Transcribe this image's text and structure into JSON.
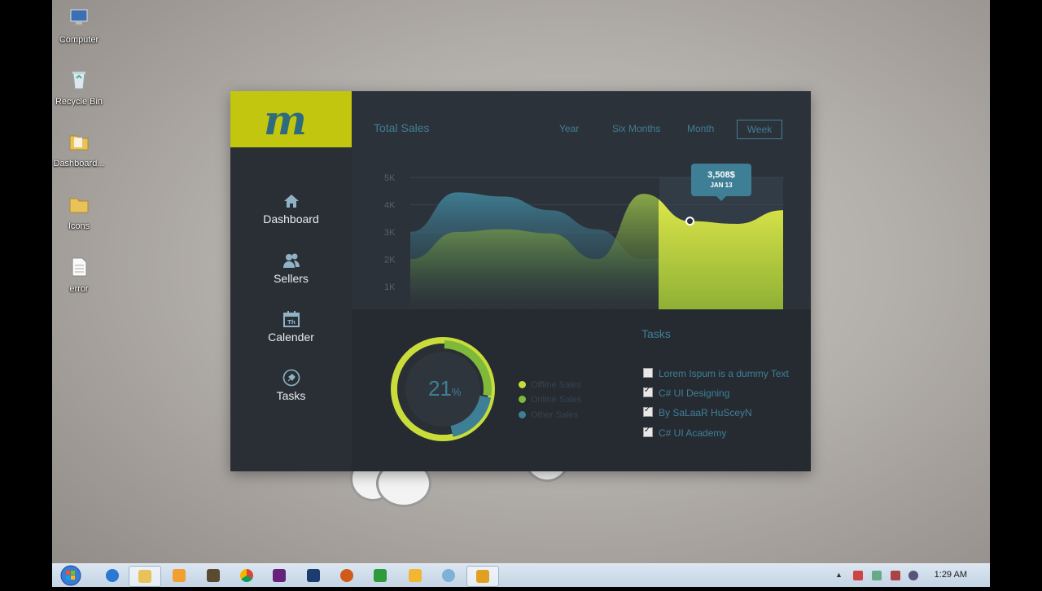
{
  "desktop": {
    "icons": [
      {
        "label": "Computer",
        "icon": "computer-icon"
      },
      {
        "label": "Recycle Bin",
        "icon": "recycle-bin-icon"
      },
      {
        "label": "Dashboard...",
        "icon": "folder-icon"
      },
      {
        "label": "Icons",
        "icon": "folder-icon"
      },
      {
        "label": "error",
        "icon": "text-file-icon"
      }
    ]
  },
  "app": {
    "logo_letter": "m",
    "nav": [
      {
        "label": "Dashboard",
        "icon": "home-icon",
        "active": true
      },
      {
        "label": "Sellers",
        "icon": "users-icon",
        "active": false
      },
      {
        "label": "Calender",
        "icon": "calendar-icon",
        "active": false
      },
      {
        "label": "Tasks",
        "icon": "pin-icon",
        "active": false
      }
    ],
    "header": {
      "title": "Total Sales",
      "periods": [
        "Year",
        "Six Months",
        "Month",
        "Week"
      ],
      "selected_period": "Week"
    },
    "tooltip": {
      "value": "3,508$",
      "date": "JAN 13"
    },
    "donut": {
      "percent": "21",
      "unit": "%"
    },
    "legend": [
      {
        "label": "Offline Sales",
        "color": "#c9dc3a"
      },
      {
        "label": "Online Sales",
        "color": "#7fb93a"
      },
      {
        "label": "Other Sales",
        "color": "#3f7f96"
      }
    ],
    "tasks": {
      "title": "Tasks",
      "items": [
        {
          "label": "Lorem Ispum is a dummy Text",
          "checked": false
        },
        {
          "label": "C# UI Designing",
          "checked": true
        },
        {
          "label": "By SaLaaR HuSceyN",
          "checked": true
        },
        {
          "label": "C# UI Academy",
          "checked": true
        }
      ]
    },
    "colors": {
      "accent": "#c3c60f",
      "teal": "#3f7f96",
      "bg": "#2a2f36"
    }
  },
  "chart_data": {
    "type": "area",
    "y_ticks": [
      "5K",
      "4K",
      "3K",
      "2K",
      "1K"
    ],
    "ylim": [
      1000,
      5000
    ],
    "series": [
      {
        "values": [
          3000,
          4450,
          4300,
          3800,
          3100,
          2000,
          2200,
          2600,
          3500
        ]
      },
      {
        "values": [
          2000,
          3000,
          3100,
          2950,
          2000,
          4400,
          3400,
          3300,
          3800
        ]
      }
    ],
    "highlight": {
      "index": 6
    }
  },
  "taskbar": {
    "clock": "1:29 AM",
    "apps": [
      "ie-icon",
      "explorer-icon",
      "media-player-icon",
      "movie-maker-icon",
      "chrome-icon",
      "visual-studio-icon",
      "photoshop-icon",
      "app-icon",
      "camtasia-icon",
      "sticky-icon",
      "paint-icon",
      "dashboard-app-icon"
    ]
  }
}
